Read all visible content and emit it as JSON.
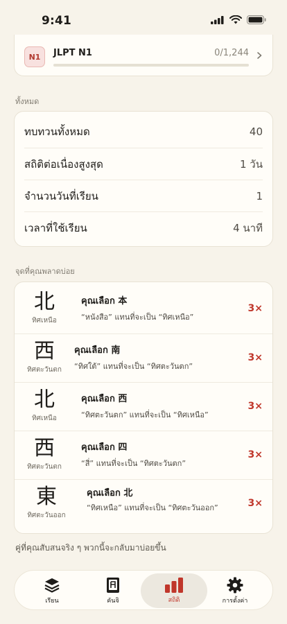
{
  "status": {
    "time": "9:41"
  },
  "jlpt": {
    "badge": "N1",
    "title": "JLPT N1",
    "count": "0/1,244",
    "progress": 0
  },
  "overall": {
    "section_label": "ทั้งหมด",
    "rows": [
      {
        "label": "ทบทวนทั้งหมด",
        "value": "40"
      },
      {
        "label": "สถิติต่อเนื่องสูงสุด",
        "value": "1 วัน"
      },
      {
        "label": "จำนวนวันที่เรียน",
        "value": "1"
      },
      {
        "label": "เวลาที่ใช้เรียน",
        "value": "4 นาที"
      }
    ]
  },
  "misses": {
    "section_label": "จุดที่คุณพลาดบ่อย",
    "items": [
      {
        "kanji": "北",
        "meaning": "ทิศเหนือ",
        "chose": "คุณเลือก 本",
        "detail": "“หนังสือ” แทนที่จะเป็น “ทิศเหนือ”",
        "count": "3×"
      },
      {
        "kanji": "西",
        "meaning": "ทิศตะวันตก",
        "chose": "คุณเลือก 南",
        "detail": "“ทิศใต้” แทนที่จะเป็น “ทิศตะวันตก”",
        "count": "3×"
      },
      {
        "kanji": "北",
        "meaning": "ทิศเหนือ",
        "chose": "คุณเลือก 西",
        "detail": "“ทิศตะวันตก” แทนที่จะเป็น “ทิศเหนือ”",
        "count": "3×"
      },
      {
        "kanji": "西",
        "meaning": "ทิศตะวันตก",
        "chose": "คุณเลือก 四",
        "detail": "“สี่” แทนที่จะเป็น “ทิศตะวันตก”",
        "count": "3×"
      },
      {
        "kanji": "東",
        "meaning": "ทิศตะวันออก",
        "chose": "คุณเลือก 北",
        "detail": "“ทิศเหนือ” แทนที่จะเป็น “ทิศตะวันออก”",
        "count": "3×"
      }
    ],
    "footnote": "คู่ที่คุณสับสนจริง ๆ พวกนี้จะกลับมาบ่อยขึ้น"
  },
  "tabs": [
    {
      "label": "เรียน",
      "icon": "layers-icon"
    },
    {
      "label": "คันจิ",
      "icon": "kanji-book-icon"
    },
    {
      "label": "สถิติ",
      "icon": "bar-chart-icon",
      "active": true
    },
    {
      "label": "การตั้งค่า",
      "icon": "gear-icon"
    }
  ],
  "colors": {
    "accent": "#c0372b",
    "background": "#f7f3ea",
    "card": "#fffdf8"
  }
}
